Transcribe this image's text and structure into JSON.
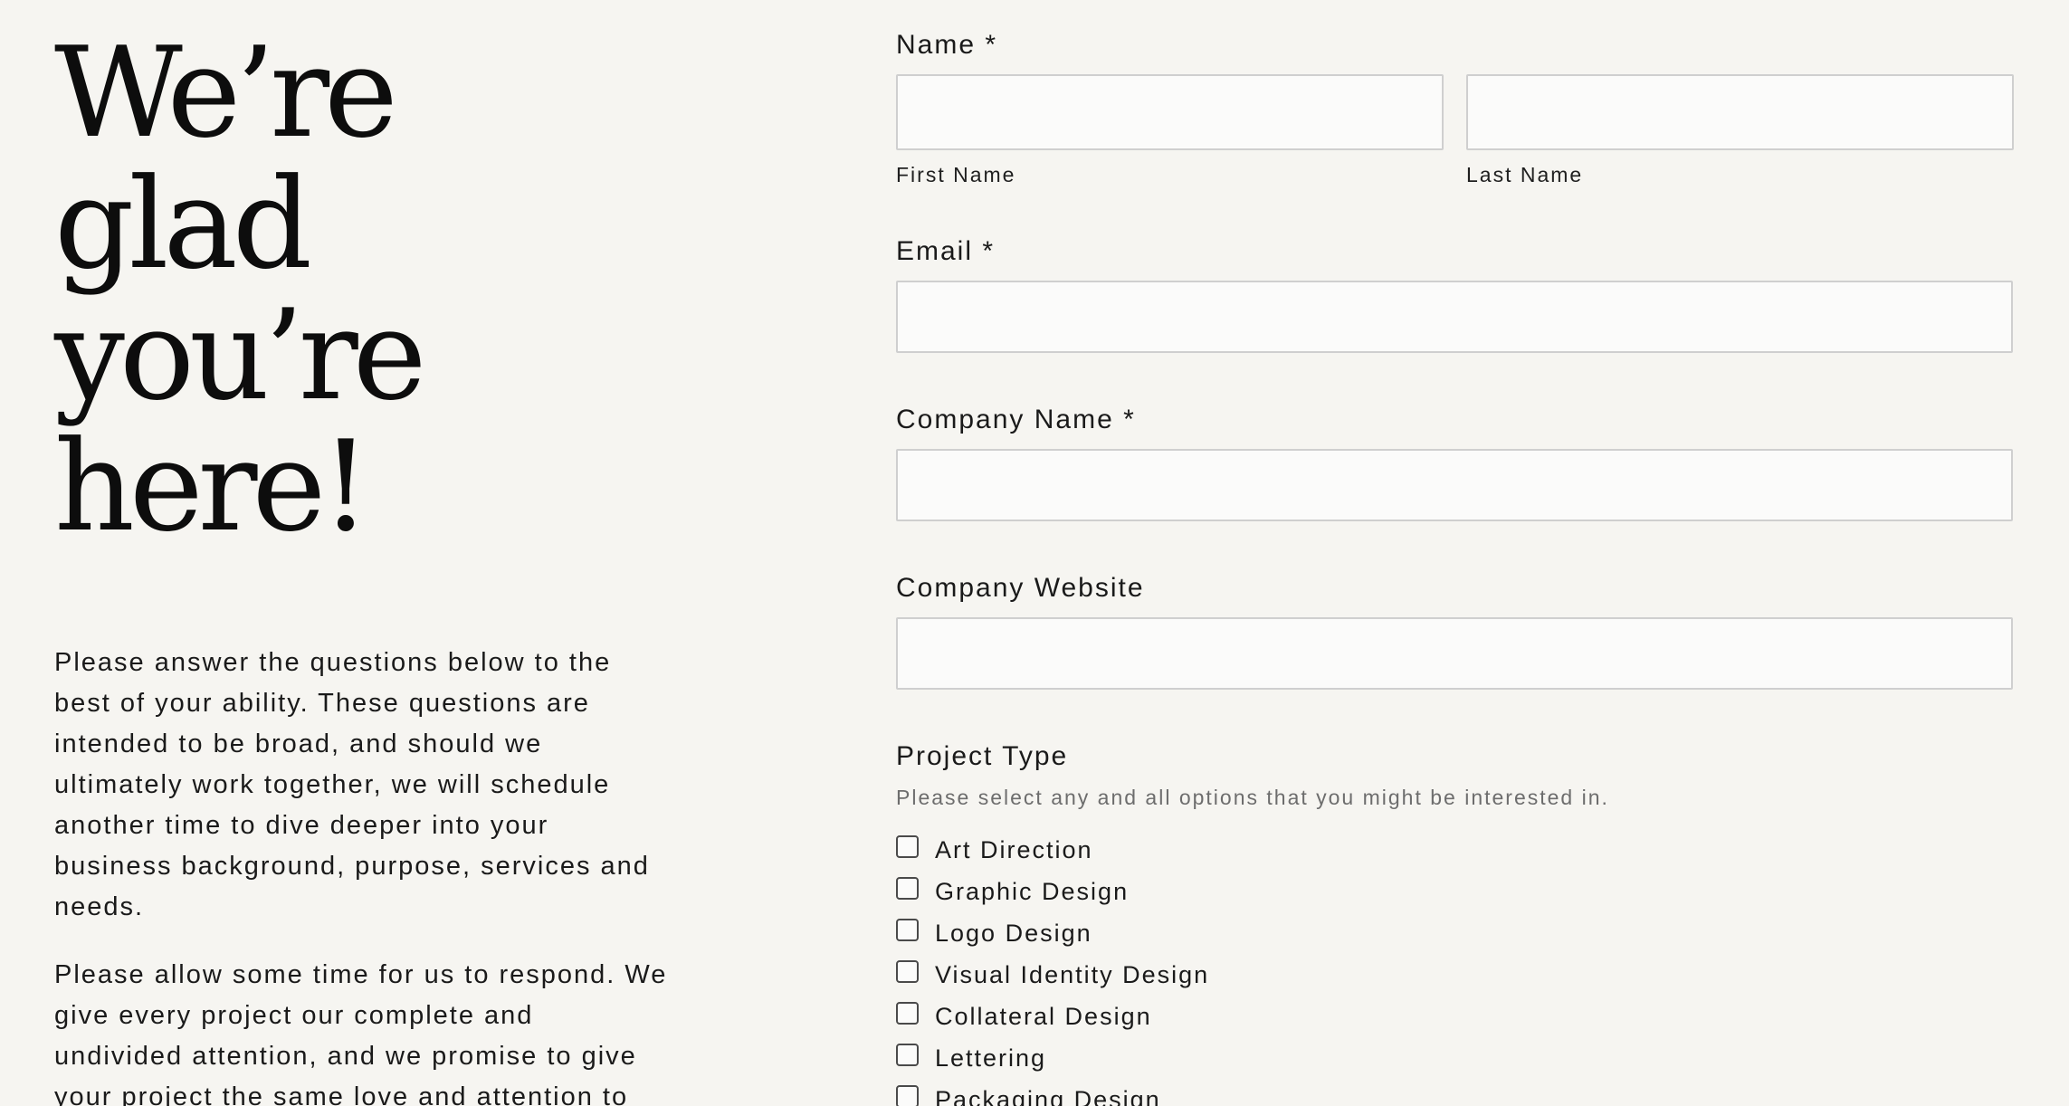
{
  "intro": {
    "headline_line1": "We’re glad",
    "headline_line2": "you’re here!",
    "paragraph1": "Please answer the questions below to the best of your ability. These questions are intended to be broad, and should we ultimately work together, we will schedule another time to dive deeper into your business background, purpose, services and needs.",
    "paragraph2": "Please allow some time for us to respond. We give every project our complete and undivided attention, and we promise to give your project the same love and attention to detail."
  },
  "form": {
    "name": {
      "label": "Name *",
      "first_value": "",
      "last_value": "",
      "first_sublabel": "First Name",
      "last_sublabel": "Last Name"
    },
    "email": {
      "label": "Email *",
      "value": ""
    },
    "company_name": {
      "label": "Company Name *",
      "value": ""
    },
    "company_website": {
      "label": "Company Website",
      "value": ""
    },
    "project_type": {
      "label": "Project Type",
      "help": "Please select any and all options that you might be interested in.",
      "options": [
        {
          "label": "Art Direction",
          "checked": false
        },
        {
          "label": "Graphic Design",
          "checked": false
        },
        {
          "label": "Logo Design",
          "checked": false
        },
        {
          "label": "Visual Identity Design",
          "checked": false
        },
        {
          "label": "Collateral Design",
          "checked": false
        },
        {
          "label": "Lettering",
          "checked": false
        },
        {
          "label": "Packaging Design",
          "checked": false
        }
      ]
    }
  },
  "colors": {
    "background": "#f6f5f1",
    "input_background": "#fbfbfa",
    "input_border": "#cfcfcf",
    "text": "#121212",
    "help_text": "#6d6d6d"
  }
}
